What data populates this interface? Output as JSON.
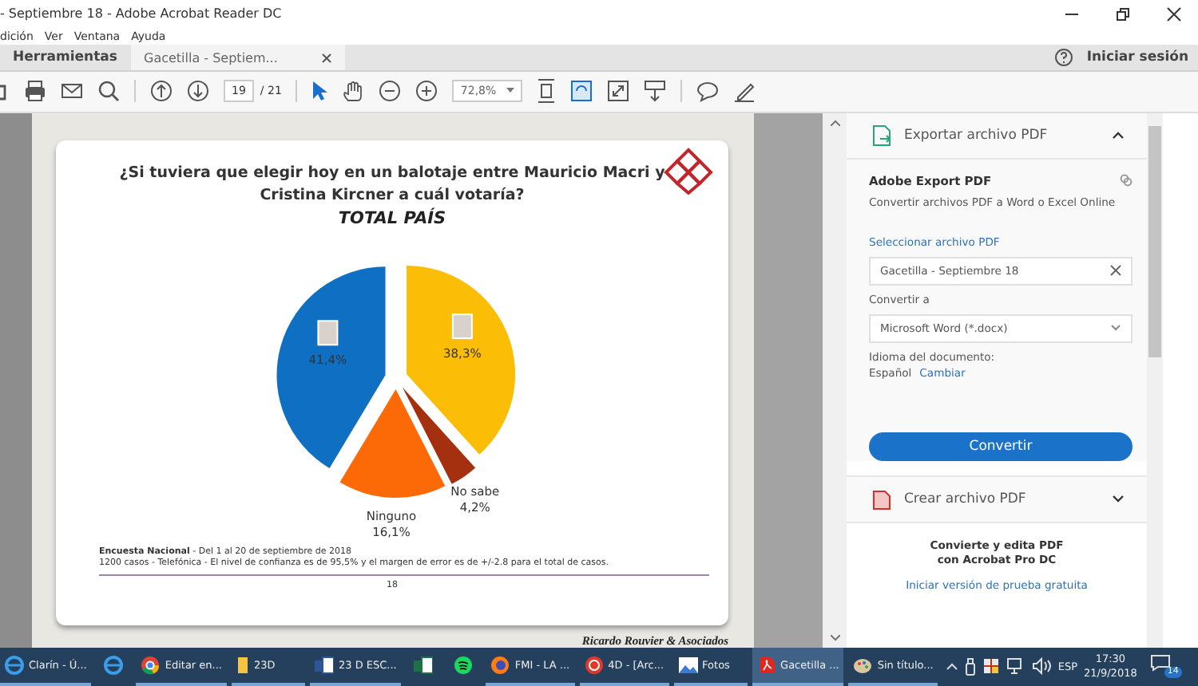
{
  "window": {
    "title": "- Septiembre 18 - Adobe Acrobat Reader DC"
  },
  "menu": [
    "dición",
    "Ver",
    "Ventana",
    "Ayuda"
  ],
  "tabs": [
    {
      "label": "Herramientas",
      "selected": false
    },
    {
      "label": "Gacetilla  - Septiem...",
      "selected": true
    }
  ],
  "account": {
    "label": "Iniciar sesión"
  },
  "toolbar": {
    "page": "19",
    "page_total": "/ 21",
    "zoom": "72,8%"
  },
  "document": {
    "title_lines": [
      "¿Si tuviera que elegir hoy en un balotaje entre Mauricio Macri y",
      "Cristina Kircner a cuál votaría?"
    ],
    "subtitle": "TOTAL PAÍS",
    "chart": {
      "chart_data": {
        "type": "pie",
        "values": [
          38.3,
          4.2,
          16.1,
          41.4
        ],
        "value_labels": [
          "38,3%",
          "4,2%",
          "16,1%",
          "41,4%"
        ],
        "colors": [
          "#fbbd05",
          "#a5300f",
          "#fb6a07",
          "#0f6fc2"
        ]
      },
      "slices": [
        {
          "kind": "photo"
        },
        {
          "kind": "named",
          "name": "No sabe"
        },
        {
          "kind": "named",
          "name": "Ninguno"
        },
        {
          "kind": "photo"
        }
      ]
    },
    "footnote_1": "**Encuesta Nacional**  - Del 1 al 20 de septiembre de 2018",
    "footnote_2": "1200 casos - Telefónica  - El nivel de confianza es de 95,5% y el margen de error es de +/-2.8 para el total de casos.",
    "page_number": "18",
    "credit": "Ricardo Rouvier & Asociados"
  },
  "panel": {
    "export_header": "Exportar archivo PDF",
    "export_title": "Adobe Export PDF",
    "export_desc": "Convertir archivos PDF a Word o Excel Online",
    "select_link": "Seleccionar archivo PDF",
    "file_value": "Gacetilla - Septiembre 18",
    "convert_to_label": "Convertir a",
    "format_value": "Microsoft Word (*.docx)",
    "language_label": "Idioma del documento:",
    "language_value": "Español",
    "language_change": "Cambiar",
    "convert_button": "Convertir",
    "create_header": "Crear archivo PDF",
    "promo_lines": [
      "Convierte y edita PDF",
      "con Acrobat Pro DC"
    ],
    "trial_link": "Iniciar versión de prueba gratuita"
  },
  "taskbar": {
    "items": [
      {
        "kind": "edge",
        "label": "Clarín - Ú...",
        "selected": false
      },
      {
        "kind": "ie",
        "selected": false
      },
      {
        "kind": "chrome",
        "label": "Editar en...",
        "selected": false
      },
      {
        "kind": "folder",
        "label": "23D",
        "selected": false
      },
      {
        "kind": "word",
        "label": "23 D ESC...",
        "selected": false
      },
      {
        "kind": "excel",
        "selected": false
      },
      {
        "kind": "spotify",
        "selected": false
      },
      {
        "kind": "firefox",
        "label": "FMI - LA ...",
        "selected": false
      },
      {
        "kind": "app4d",
        "label": "4D - [Arc...",
        "selected": false
      },
      {
        "kind": "photos",
        "label": "Fotos",
        "selected": false
      },
      {
        "kind": "pdf",
        "label": "Gacetilla ...",
        "selected": true
      },
      {
        "kind": "paint",
        "label": "Sin título...",
        "selected": false
      }
    ],
    "language": "ESP",
    "time": "17:30",
    "date": "21/9/2018",
    "notifications": "14"
  }
}
